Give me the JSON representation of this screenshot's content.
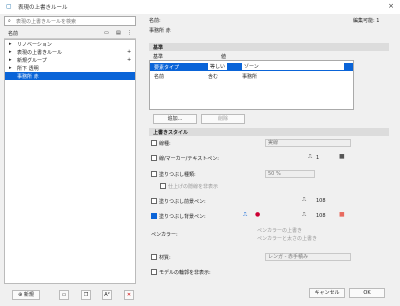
{
  "window": {
    "title": "表現の上書きルール",
    "close_icon": "×"
  },
  "left": {
    "search_placeholder": "表現の上書きルールを検索",
    "col_name": "名前",
    "tree": [
      {
        "expander": "",
        "label": "名前"
      },
      {
        "expander": "▸",
        "label": "リノベーション"
      },
      {
        "expander": "▸",
        "label": "表現の上書きルール"
      },
      {
        "expander": "▸",
        "label": "新規グループ"
      },
      {
        "expander": "▸",
        "label": "所下 透明"
      },
      {
        "expander": "",
        "label": "事務所 赤"
      }
    ],
    "footer": {
      "new": "新規",
      "a2": "A²"
    }
  },
  "right": {
    "name_label": "名前:",
    "name_value": "事務所 赤",
    "editable": "編集可能: 1",
    "basic_section": "基準",
    "criteria_cols": {
      "c1": "基準",
      "c2": "値"
    },
    "criteria_row": {
      "a": "要素タイプ",
      "b": "等しい",
      "c": "ゾーン"
    },
    "criteria_row2": {
      "a": "名前",
      "b": "含む",
      "c": "事務所"
    },
    "add_btn": "追加...",
    "delete_btn": "削除",
    "style_section": "上書きスタイル",
    "opts": {
      "line": "線種:",
      "line_value": "実線",
      "pen": "線/マーカー/テキストペン:",
      "pen_value": "1",
      "fill": "塗りつぶし種類:",
      "fill_value": "50 %",
      "fill_sub": "仕上げの隠線を非表示",
      "fill_fg": "塗りつぶし前景ペン:",
      "fill_fg_value": "108",
      "fill_bg": "塗りつぶし背景ペン:",
      "fill_bg_value": "108",
      "pen_color": "ペンカラー:",
      "pen_color_1": "ペンカラーの上書き",
      "pen_color_2": "ペンカラーと太さの上書き",
      "material": "材質:",
      "material_value": "レンガ - 赤手積み",
      "model": "モデルの輪郭を非表示:"
    },
    "cancel": "キャンセル",
    "ok": "OK"
  }
}
